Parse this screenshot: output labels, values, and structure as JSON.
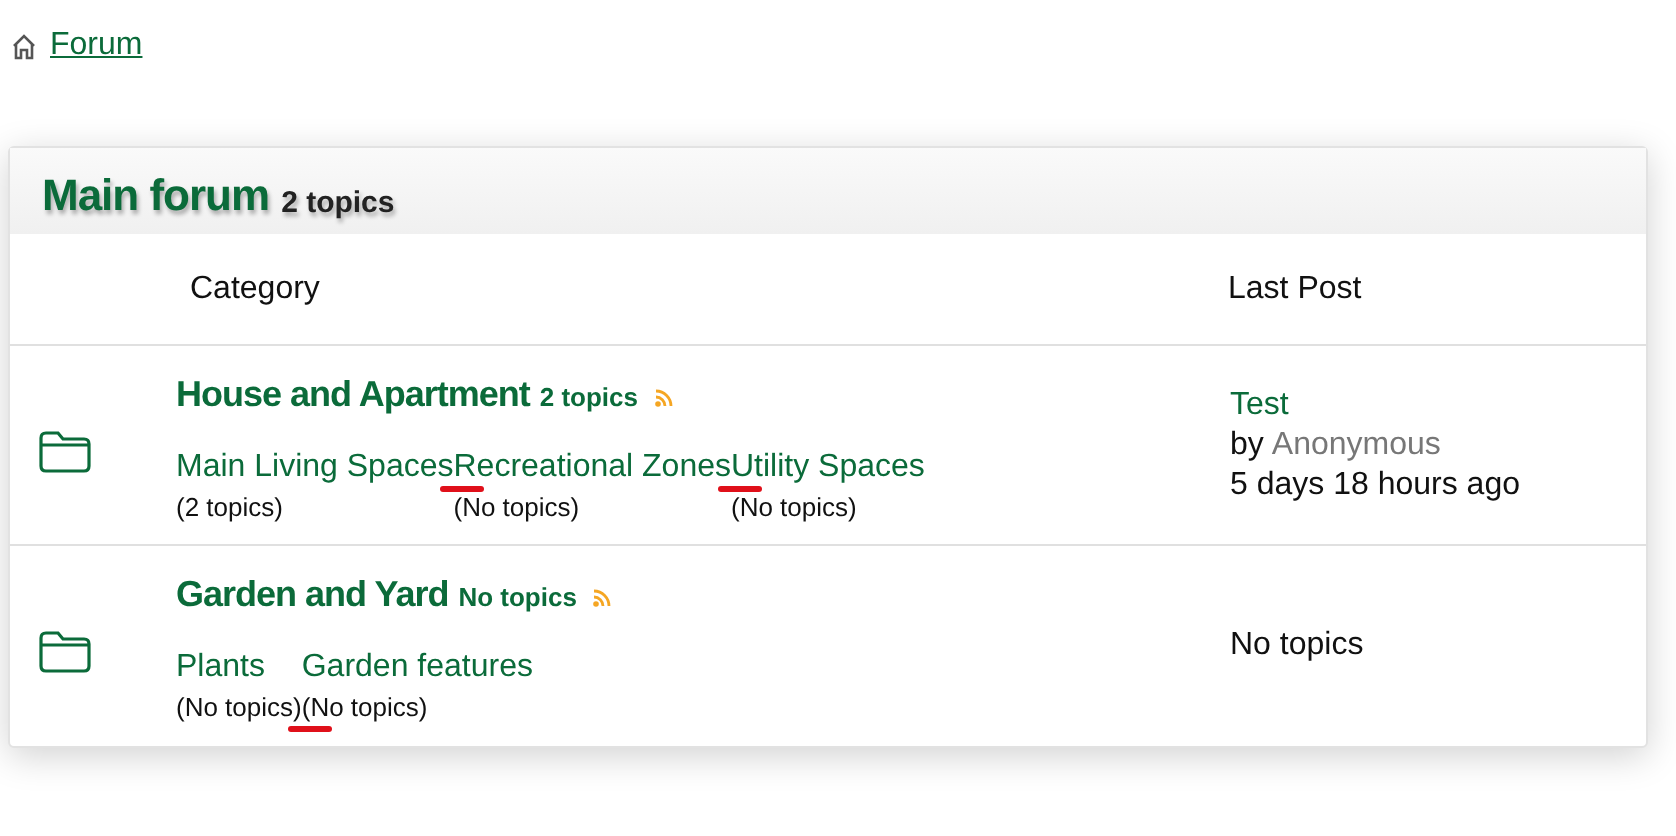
{
  "breadcrumb": {
    "label": "Forum"
  },
  "forum": {
    "title": "Main forum",
    "count": "2 topics",
    "columns": [
      "Category",
      "Last Post"
    ],
    "categories": [
      {
        "name": "House and Apartment",
        "count": "2 topics",
        "subforums": [
          {
            "name": "Main Living Spaces",
            "count": "(2 topics)"
          },
          {
            "name": "Recreational Zones",
            "count": "(No topics)",
            "name_marked": true
          },
          {
            "name": "Utility Spaces",
            "count": "(No topics)",
            "name_marked": true
          }
        ],
        "last_post": {
          "title": "Test",
          "by": "by",
          "author": "Anonymous",
          "time": "5 days 18 hours ago"
        }
      },
      {
        "name": "Garden and Yard",
        "count": "No topics",
        "subforums": [
          {
            "name": "Plants",
            "count": "(No topics)"
          },
          {
            "name": "Garden features",
            "count": "(No topics)",
            "count_marked": true
          }
        ],
        "last_post": {
          "empty": "No topics"
        }
      }
    ]
  }
}
